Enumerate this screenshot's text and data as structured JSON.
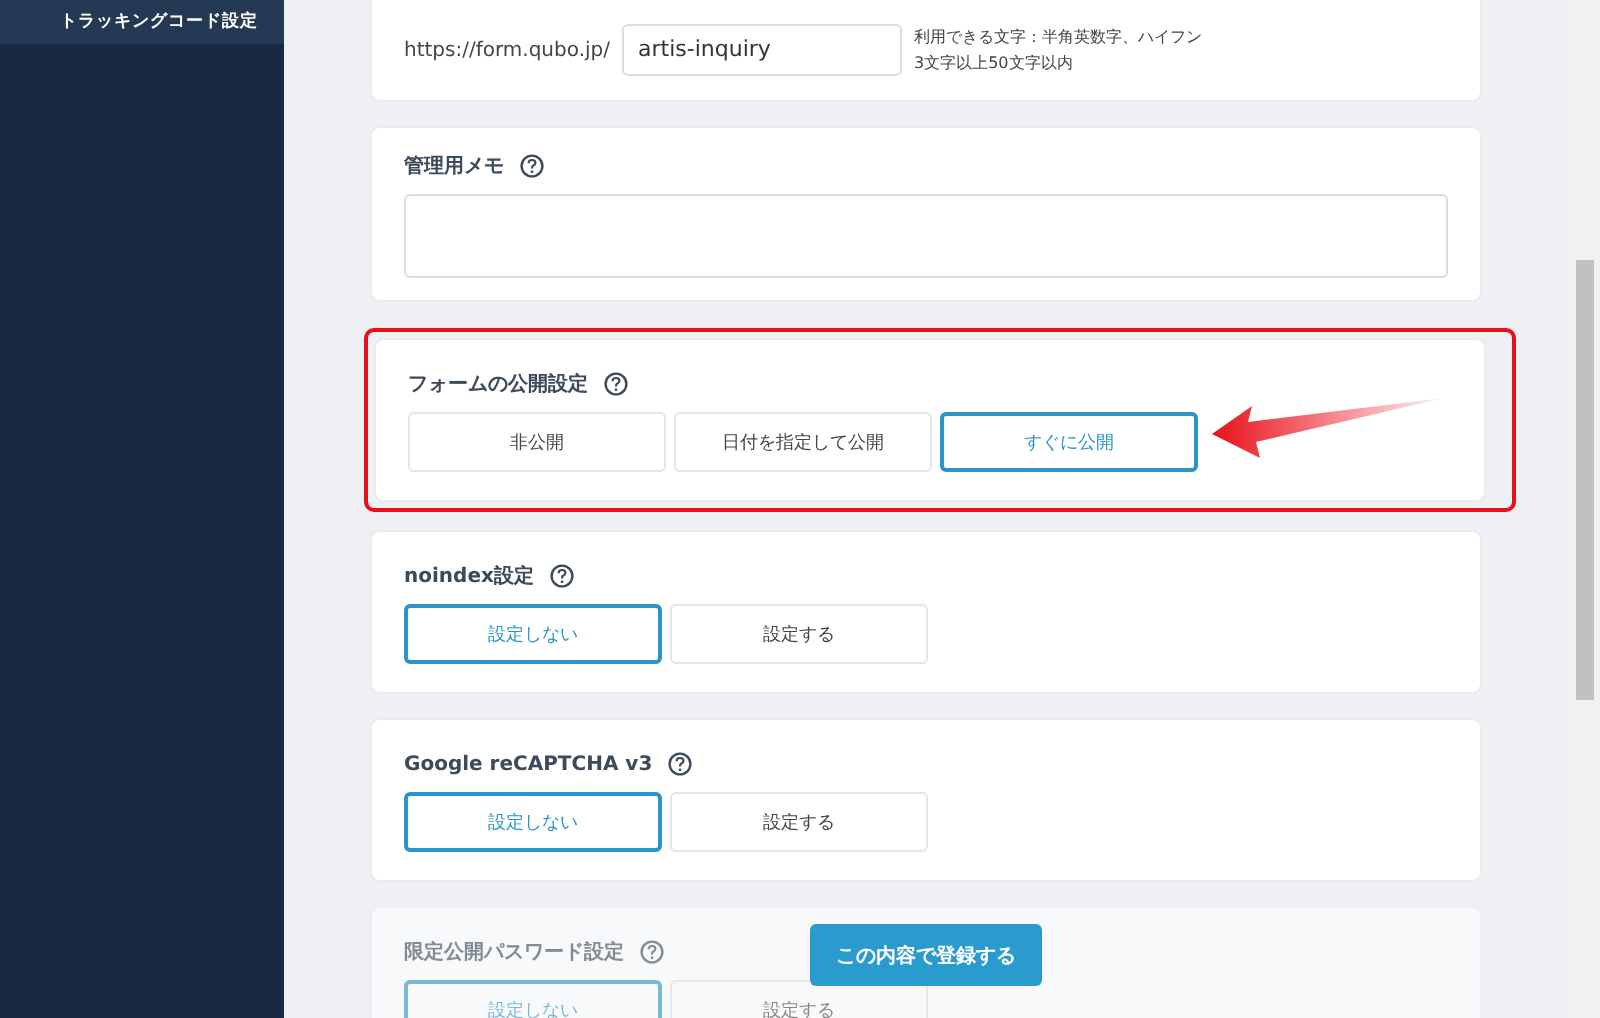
{
  "sidebar": {
    "items": [
      {
        "label": "トラッキングコード設定",
        "selected": true
      }
    ]
  },
  "sections": [
    {
      "kind": "url",
      "prefix": "https://form.qubo.jp/",
      "value": "artis-inquiry",
      "hint": [
        "利用できる文字：半角英数字、ハイフン",
        "3文字以上50文字以内"
      ]
    },
    {
      "kind": "memo",
      "title": "管理用メモ"
    },
    {
      "kind": "options",
      "title": "フォームの公開設定",
      "highlighted": true,
      "faded": false,
      "options": [
        {
          "label": "非公開",
          "selected": false
        },
        {
          "label": "日付を指定して公開",
          "selected": false
        },
        {
          "label": "すぐに公開",
          "selected": true
        }
      ]
    },
    {
      "kind": "options",
      "title": "noindex設定",
      "highlighted": false,
      "faded": false,
      "options": [
        {
          "label": "設定しない",
          "selected": true
        },
        {
          "label": "設定する",
          "selected": false
        }
      ]
    },
    {
      "kind": "options",
      "title": "Google reCAPTCHA v3",
      "highlighted": false,
      "faded": false,
      "options": [
        {
          "label": "設定しない",
          "selected": true
        },
        {
          "label": "設定する",
          "selected": false
        }
      ]
    },
    {
      "kind": "options",
      "title": "限定公開パスワード設定",
      "highlighted": false,
      "faded": true,
      "options": [
        {
          "label": "設定しない",
          "selected": true
        },
        {
          "label": "設定する",
          "selected": false
        }
      ]
    }
  ],
  "submit_button": "この内容で登録する"
}
